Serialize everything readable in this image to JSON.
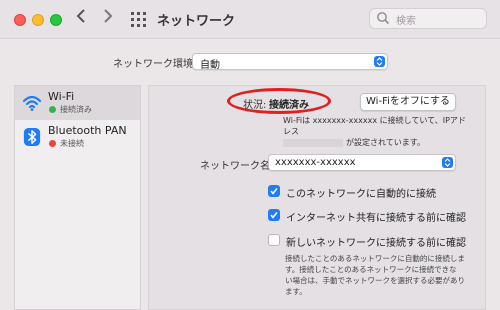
{
  "window": {
    "title": "ネットワーク"
  },
  "search": {
    "placeholder": "検索"
  },
  "location": {
    "label": "ネットワーク環境:",
    "value": "自動"
  },
  "services": [
    {
      "name": "Wi-Fi",
      "status": "接続済み",
      "status_color": "#2fb84a",
      "icon": "wifi-icon",
      "selected": true
    },
    {
      "name": "Bluetooth PAN",
      "status": "未接続",
      "status_color": "#e8453c",
      "icon": "bluetooth-icon",
      "selected": false
    }
  ],
  "detail": {
    "status_label": "状況:",
    "status_value": "接続済み",
    "toggle_button": "Wi-Fiをオフにする",
    "description_line1": "Wi-Fiは xxxxxxx-xxxxxx に接続していて、IPアドレス",
    "description_line2": "が設定されています。",
    "network_name_label": "ネットワーク名:",
    "network_name_value": "xxxxxxx-xxxxxx",
    "options": [
      {
        "label": "このネットワークに自動的に接続",
        "checked": true
      },
      {
        "label": "インターネット共有に接続する前に確認",
        "checked": true
      },
      {
        "label": "新しいネットワークに接続する前に確認",
        "checked": false
      }
    ],
    "note_line1": "接続したことのあるネットワークに自動的に接続しま",
    "note_line2": "す。接続したことのあるネットワークに接続できな",
    "note_line3": "い場合は、手動でネットワークを選択する必要があり",
    "note_line4": "ます。"
  },
  "colors": {
    "accent": "#1f7cf5",
    "highlight": "#e02020"
  }
}
